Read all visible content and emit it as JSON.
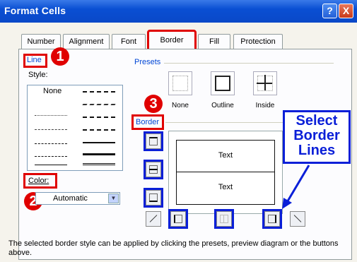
{
  "window": {
    "title": "Format Cells",
    "help_label": "?",
    "close_label": "X"
  },
  "tabs": [
    {
      "label": "Number"
    },
    {
      "label": "Alignment"
    },
    {
      "label": "Font"
    },
    {
      "label": "Border",
      "active": true
    },
    {
      "label": "Fill"
    },
    {
      "label": "Protection"
    }
  ],
  "line_group": {
    "label": "Line",
    "style_label": "Style:",
    "none_label": "None",
    "color_label": "Color:",
    "color_value": "Automatic"
  },
  "presets": {
    "label": "Presets",
    "items": [
      {
        "label": "None"
      },
      {
        "label": "Outline"
      },
      {
        "label": "Inside"
      }
    ]
  },
  "border_group": {
    "label": "Border"
  },
  "preview": {
    "cell_top": "Text",
    "cell_bottom": "Text"
  },
  "description": "The selected border style can be applied by clicking the presets, preview diagram or the buttons above.",
  "annotations": {
    "badge_1": "1",
    "badge_2": "2",
    "badge_3": "3",
    "callout_lines": [
      "Select",
      "Border",
      "Lines"
    ],
    "red": "#e00000",
    "blue": "#0a1fd8"
  }
}
